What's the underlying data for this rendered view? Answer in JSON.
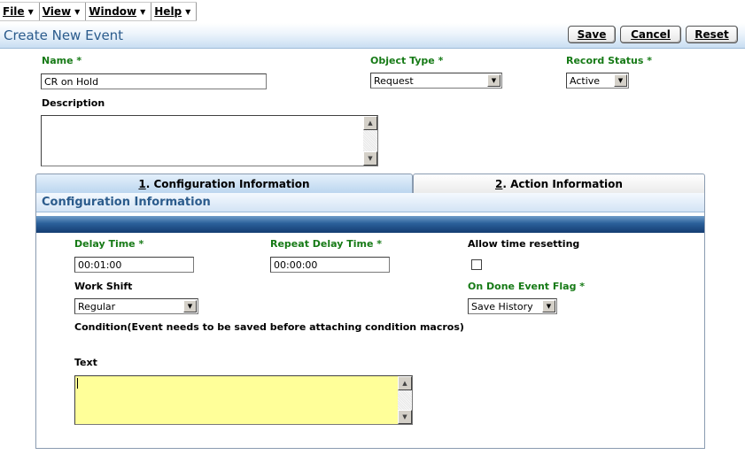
{
  "menu": {
    "items": [
      {
        "label": "File"
      },
      {
        "label": "View"
      },
      {
        "label": "Window"
      },
      {
        "label": "Help"
      }
    ]
  },
  "header": {
    "title": "Create New Event",
    "save_label": "Save",
    "cancel_label": "Cancel",
    "reset_label": "Reset"
  },
  "form": {
    "name_label": "Name *",
    "name_value": "CR on Hold",
    "object_type_label": "Object Type *",
    "object_type_value": "Request",
    "record_status_label": "Record Status *",
    "record_status_value": "Active",
    "description_label": "Description",
    "description_value": ""
  },
  "tabs": [
    {
      "num": "1",
      "label": ". Configuration Information"
    },
    {
      "num": "2",
      "label": ". Action Information"
    }
  ],
  "config": {
    "section_title": "Configuration Information",
    "delay_time_label": "Delay Time *",
    "delay_time_value": "00:01:00",
    "repeat_delay_label": "Repeat Delay Time *",
    "repeat_delay_value": "00:00:00",
    "allow_reset_label": "Allow time resetting",
    "allow_reset_checked": false,
    "work_shift_label": "Work Shift",
    "work_shift_value": "Regular",
    "on_done_label": "On Done Event Flag *",
    "on_done_value": "Save History",
    "condition_label": "Condition(Event needs to be saved before attaching condition macros)",
    "text_label": "Text",
    "text_value": ""
  },
  "colors": {
    "required_label": "#167a16",
    "title_blue": "#2b5b8c",
    "text_area_bg": "#ffff99"
  }
}
